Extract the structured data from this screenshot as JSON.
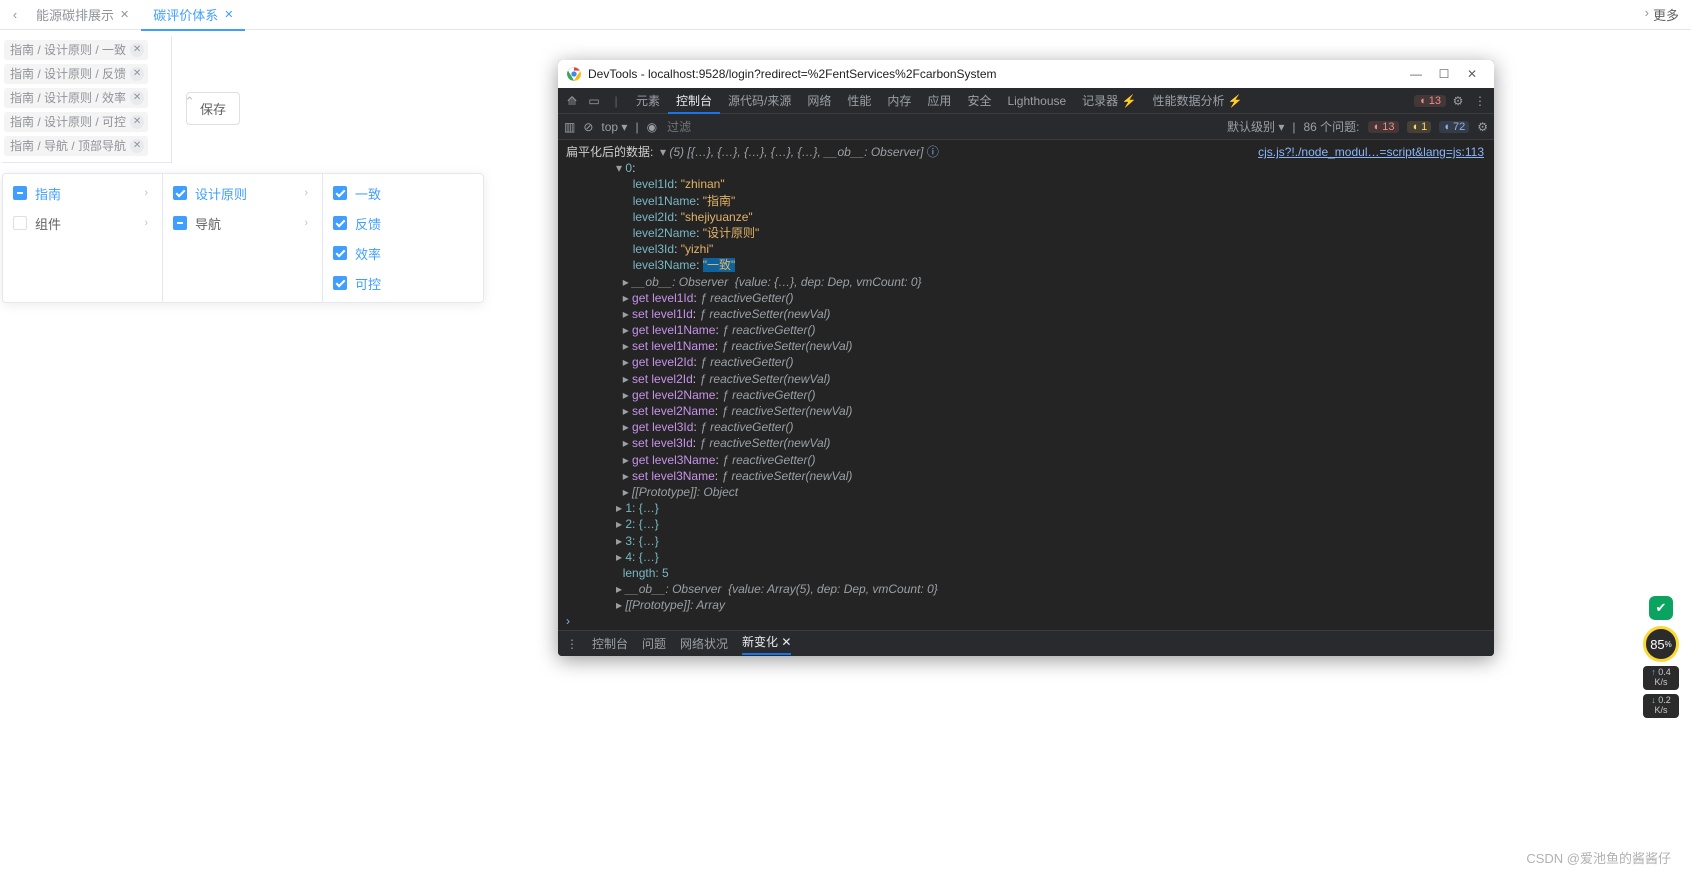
{
  "app_tabs": {
    "prev": "‹",
    "next": "›",
    "more": "更多",
    "tabs": [
      {
        "label": "能源碳排展示",
        "active": false
      },
      {
        "label": "碳评价体系",
        "active": true
      }
    ]
  },
  "tags": [
    "指南 / 设计原则 / 一致",
    "指南 / 设计原则 / 反馈",
    "指南 / 设计原则 / 效率",
    "指南 / 设计原则 / 可控",
    "指南 / 导航 / 顶部导航"
  ],
  "save_label": "保存",
  "cascader": {
    "col1": [
      {
        "label": "指南",
        "state": "ind",
        "chev": true,
        "sel": true
      },
      {
        "label": "组件",
        "state": "off",
        "chev": true
      }
    ],
    "col2": [
      {
        "label": "设计原则",
        "state": "chk",
        "chev": true,
        "sel": true
      },
      {
        "label": "导航",
        "state": "ind",
        "chev": true
      }
    ],
    "col3": [
      {
        "label": "一致",
        "state": "chk",
        "sel": true
      },
      {
        "label": "反馈",
        "state": "chk",
        "sel": true
      },
      {
        "label": "效率",
        "state": "chk",
        "sel": true
      },
      {
        "label": "可控",
        "state": "chk",
        "sel": true
      }
    ]
  },
  "devtools": {
    "title": "DevTools - localhost:9528/login?redirect=%2FentServices%2FcarbonSystem",
    "tabs": [
      "元素",
      "控制台",
      "源代码/来源",
      "网络",
      "性能",
      "内存",
      "应用",
      "安全",
      "Lighthouse",
      "记录器 ⚡",
      "性能数据分析 ⚡"
    ],
    "active_tab": "控制台",
    "errors": "13",
    "filter": {
      "context": "top",
      "placeholder": "过滤",
      "level": "默认级别",
      "issues_label": "86 个问题:",
      "err": "13",
      "warn": "1",
      "info": "72"
    },
    "source_link": "cjs.js?!./node_modul…=script&lang=js:113",
    "log_label": "扁平化后的数据:",
    "array_summary": "(5) [{…}, {…}, {…}, {…}, {…}, __ob__: Observer]",
    "obj": [
      {
        "k": "level1Id",
        "v": "\"zhinan\""
      },
      {
        "k": "level1Name",
        "v": "\"指南\""
      },
      {
        "k": "level2Id",
        "v": "\"shejiyuanze\""
      },
      {
        "k": "level2Name",
        "v": "\"设计原则\""
      },
      {
        "k": "level3Id",
        "v": "\"yizhi\""
      },
      {
        "k": "level3Name",
        "v": "\"一致\"",
        "hl": true
      }
    ],
    "ob_line": "__ob__: Observer  {value: {…}, dep: Dep, vmCount: 0}",
    "accessors": [
      "get level1Id: ƒ reactiveGetter()",
      "set level1Id: ƒ reactiveSetter(newVal)",
      "get level1Name: ƒ reactiveGetter()",
      "set level1Name: ƒ reactiveSetter(newVal)",
      "get level2Id: ƒ reactiveGetter()",
      "set level2Id: ƒ reactiveSetter(newVal)",
      "get level2Name: ƒ reactiveGetter()",
      "set level2Name: ƒ reactiveSetter(newVal)",
      "get level3Id: ƒ reactiveGetter()",
      "set level3Id: ƒ reactiveSetter(newVal)",
      "get level3Name: ƒ reactiveGetter()",
      "set level3Name: ƒ reactiveSetter(newVal)"
    ],
    "proto": "[[Prototype]]: Object",
    "rest": [
      "1: {…}",
      "2: {…}",
      "3: {…}",
      "4: {…}"
    ],
    "length": "length: 5",
    "ob2": "__ob__: Observer  {value: Array(5), dep: Dep, vmCount: 0}",
    "proto2": "[[Prototype]]: Array",
    "drawer": [
      "控制台",
      "问题",
      "网络状况",
      "新变化"
    ],
    "drawer_active": "新变化"
  },
  "perf": {
    "ring": "85",
    "up": "0.4",
    "dn": "0.2",
    "unit": "K/s"
  },
  "watermark": "CSDN @爱池鱼的酱酱仔"
}
